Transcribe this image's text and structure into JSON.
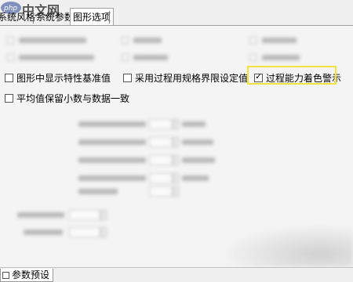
{
  "watermark": {
    "text": "中文网",
    "logo_text": "php"
  },
  "tabs": [
    {
      "label": "系统风格",
      "active": false
    },
    {
      "label": "系统参数",
      "active": false
    },
    {
      "label": "图形选项",
      "active": true
    }
  ],
  "options": {
    "show_spec_baseline": {
      "label": "图形中显示特性基准值",
      "checked": false
    },
    "use_process_spec_limits": {
      "label": "采用过程用规格界限设定值",
      "checked": false
    },
    "process_capability_alert": {
      "label": "过程能力着色警示",
      "checked": true
    },
    "mean_decimal_consistent": {
      "label": "平均值保留小数与数据一致",
      "checked": false
    }
  },
  "bottom_tab": {
    "label": "参数预设",
    "icon": "checkbox-icon"
  },
  "colors": {
    "highlight": "#f3e23a",
    "panel": "#f4f4f4",
    "window": "#f0f0f0"
  }
}
